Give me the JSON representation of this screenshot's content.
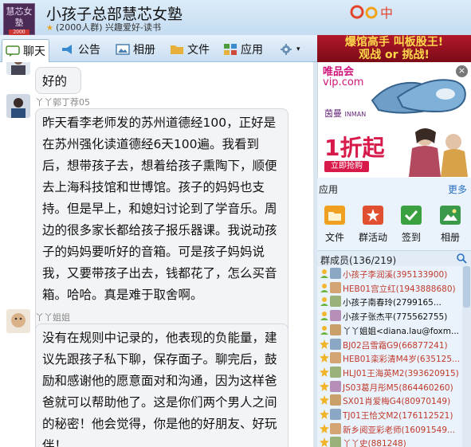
{
  "header": {
    "avatar_text": "慧芯女塾",
    "avatar_tag": "2000",
    "group_name": "小孩子总部慧芯女塾",
    "group_sub": "(2000人群) 兴趣爱好-读书",
    "logo_text": "中"
  },
  "top_ad": {
    "line1": "爆馆高手 叫板股王!",
    "line2": "观战 or 挑战!"
  },
  "toolbar": [
    {
      "name": "tab-chat",
      "label": "聊天",
      "icon": "chat-icon",
      "color": "#4a8a2f"
    },
    {
      "name": "tab-announcement",
      "label": "公告",
      "icon": "announcement-icon",
      "color": "#3a8ad0"
    },
    {
      "name": "tab-album",
      "label": "相册",
      "icon": "album-icon",
      "color": "#4b7fb0"
    },
    {
      "name": "tab-files",
      "label": "文件",
      "icon": "folder-icon",
      "color": "#e6b03a"
    },
    {
      "name": "tab-apps",
      "label": "应用",
      "icon": "apps-icon",
      "color": "#4a9d3a"
    }
  ],
  "messages": [
    {
      "sender": "",
      "text": "好的"
    },
    {
      "sender": "丫丫郭丁荐05",
      "text": "昨天看李老师发的苏州道德经100，正好是在苏州强化读道德经6天100遍。我看到后，想带孩子去，想着给孩子熏陶下，顺便去上海科技馆和世博馆。孩子的妈妈也支持。但是早上，和媳妇讨论到了学音乐。周边的很多家长都给孩子报乐器课。我说动孩子的妈妈要听好的音箱。可是孩子妈妈说我，又要带孩子出去，钱都花了，怎么买音箱。哈哈。真是难于取舍啊。"
    },
    {
      "sender": "丫丫姐姐",
      "text": "没有在规则中记录的，他表现的负能量，建议先跟孩子私下聊，保存面子。聊完后，鼓励和感谢他的愿意面对和沟通，因为这样爸爸就可以帮助他了。这是你们两个男人之间的秘密！他会觉得，你是他的好朋友、好玩伴！"
    }
  ],
  "side_ad": {
    "brand_top": "唯品会",
    "brand_url": "vip.com",
    "close": "×",
    "shop": "茵曼",
    "shop_en": "INMAN",
    "discount": "1折起",
    "cta": "立即抢购"
  },
  "apps": {
    "title": "应用",
    "more": "更多",
    "items": [
      {
        "name": "app-files",
        "label": "文件",
        "icon": "folder-app-icon",
        "color": "#f0a020"
      },
      {
        "name": "app-events",
        "label": "群活动",
        "icon": "event-app-icon",
        "color": "#e05030"
      },
      {
        "name": "app-checkin",
        "label": "签到",
        "icon": "checkin-app-icon",
        "color": "#3aa040"
      },
      {
        "name": "app-album",
        "label": "相册",
        "icon": "album-app-icon",
        "color": "#3a9a4a"
      }
    ]
  },
  "members": {
    "title": "群成员(136/219)",
    "list": [
      {
        "name": "小孩子李润溪(395133900)",
        "color": "#c0392b"
      },
      {
        "name": "HEB01宫立红(1943888680)",
        "color": "#c0392b"
      },
      {
        "name": "小孩子南春玲(2799165...",
        "color": "#111111"
      },
      {
        "name": "小孩子张杰平(775562755)",
        "color": "#111111"
      },
      {
        "name": "丫丫姐姐<diana.lau@foxm...",
        "color": "#111111"
      },
      {
        "name": "BJ02吕雪霜G9(66877241)",
        "color": "#c0392b"
      },
      {
        "name": "HEB01栾彩清M4岁(635125...",
        "color": "#c0392b"
      },
      {
        "name": "HLJ01王海英M2(393620915)",
        "color": "#c0392b"
      },
      {
        "name": "JS03葛月彤M5(864460260)",
        "color": "#c0392b"
      },
      {
        "name": "SX01肖爱梅G4(80970149)",
        "color": "#c0392b"
      },
      {
        "name": "TJ01王恰文M2(176112521)",
        "color": "#c0392b"
      },
      {
        "name": "新乡阅亚彩老师(16091549...",
        "color": "#c0392b"
      },
      {
        "name": "丫丫史(881248)",
        "color": "#c0392b"
      }
    ]
  }
}
